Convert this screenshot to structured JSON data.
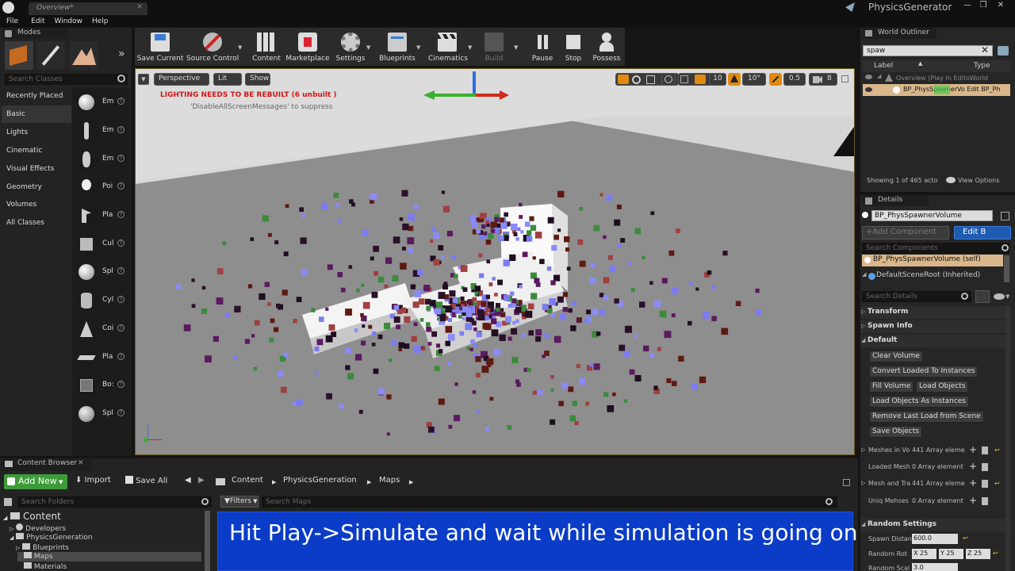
{
  "window": {
    "tab_title": "Overview*",
    "app_title": "PhysicsGenerator"
  },
  "menu": [
    "File",
    "Edit",
    "Window",
    "Help"
  ],
  "modes": {
    "tab": "Modes",
    "search_placeholder": "Search Classes",
    "categories": [
      "Recently Placed",
      "Basic",
      "Lights",
      "Cinematic",
      "Visual Effects",
      "Geometry",
      "Volumes",
      "All Classes"
    ],
    "selected_category": "Basic",
    "items": [
      "Em",
      "Em",
      "Em",
      "Poi",
      "Pla",
      "Cul",
      "Spl",
      "Cyl",
      "Coi",
      "Pla",
      "Bo:",
      "Spl"
    ]
  },
  "toolbar": {
    "buttons": [
      "Save Current",
      "Source Control",
      "Content",
      "Marketplace",
      "Settings",
      "Blueprints",
      "Cinematics",
      "Build",
      "Pause",
      "Stop",
      "Possess"
    ]
  },
  "viewport": {
    "perspective": "Perspective",
    "lit": "Lit",
    "show": "Show",
    "warning": "LIGHTING NEEDS TO BE REBUILT (6 unbuilt )",
    "warning_sub": "'DisableAllScreenMessages' to suppress",
    "grid_snap": "10",
    "rot_snap": "10°",
    "scale_snap": "0.5",
    "cam_speed": "8"
  },
  "outliner": {
    "tab": "World Outliner",
    "search_value": "spaw",
    "col_label": "Label",
    "col_type": "Type",
    "rows": [
      "Overview (Play In EditoWorld",
      "BP_PhysSpawnerVo Edit BP_Ph"
    ],
    "highlight": "Spaw",
    "status": "Showing 1 of 465 acto",
    "view_options": "View Options"
  },
  "details": {
    "tab": "Details",
    "object_name": "BP_PhysSpawnerVolume",
    "add_component": "+Add Component",
    "edit_bp": "Edit B",
    "search_components": "Search Components",
    "components": [
      "BP_PhysSpawnerVolume (self)",
      "DefaultSceneRoot (Inherited)"
    ],
    "search_details": "Search Details",
    "sections": [
      "Transform",
      "Spawn Info",
      "Default"
    ],
    "buttons": [
      "Clear Volume",
      "Convert Loaded To Instances",
      "Fill Volume",
      "Load Objects",
      "Load Objects As Instances",
      "Remove Last Load from Scene",
      "Save Objects"
    ],
    "props": [
      {
        "name": "Meshes in Vo",
        "value": "441 Array eleme"
      },
      {
        "name": "Loaded Mesh",
        "value": "0 Array element"
      },
      {
        "name": "Mesh and Tra",
        "value": "441 Array eleme"
      },
      {
        "name": "Uniq Mehses",
        "value": "0 Array element"
      }
    ],
    "random_section": "Random Settings",
    "spawn_distance_label": "Spawn Distan",
    "spawn_distance_value": "600.0",
    "random_rot_label": "Random Rot",
    "rot_x": "X 25",
    "rot_y": "Y 25",
    "rot_z": "Z 25",
    "random_scale_label": "Random Scal",
    "random_scale_value": "3.0"
  },
  "content_browser": {
    "tab": "Content Browser",
    "add_new": "Add New",
    "import": "Import",
    "save_all": "Save All",
    "path": [
      "Content",
      "PhysicsGeneration",
      "Maps"
    ],
    "search_folders": "Search Folders",
    "filters": "Filters",
    "search_maps": "Search Maps",
    "tree": [
      "Content",
      "Developers",
      "PhysicsGeneration",
      "Blueprints",
      "Maps",
      "Materials"
    ]
  },
  "caption": "Hit Play->Simulate and wait while simulation is going on"
}
